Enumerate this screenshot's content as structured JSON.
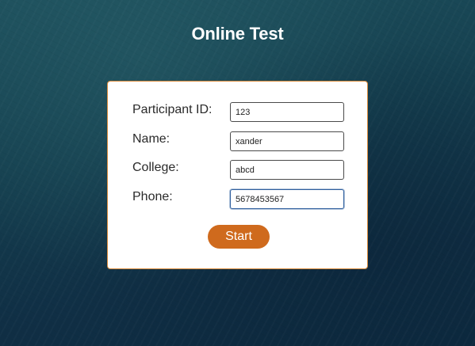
{
  "page": {
    "title": "Online Test"
  },
  "form": {
    "fields": [
      {
        "label": "Participant ID:",
        "value": "123",
        "focused": false
      },
      {
        "label": "Name:",
        "value": "xander",
        "focused": false
      },
      {
        "label": "College:",
        "value": "abcd",
        "focused": false
      },
      {
        "label": "Phone:",
        "value": "5678453567",
        "focused": true
      }
    ],
    "start_label": "Start"
  },
  "colors": {
    "background": "#153f4f",
    "card_border": "#d98a3a",
    "button": "#cf6a1d",
    "focus_border": "#2f5f9e"
  }
}
